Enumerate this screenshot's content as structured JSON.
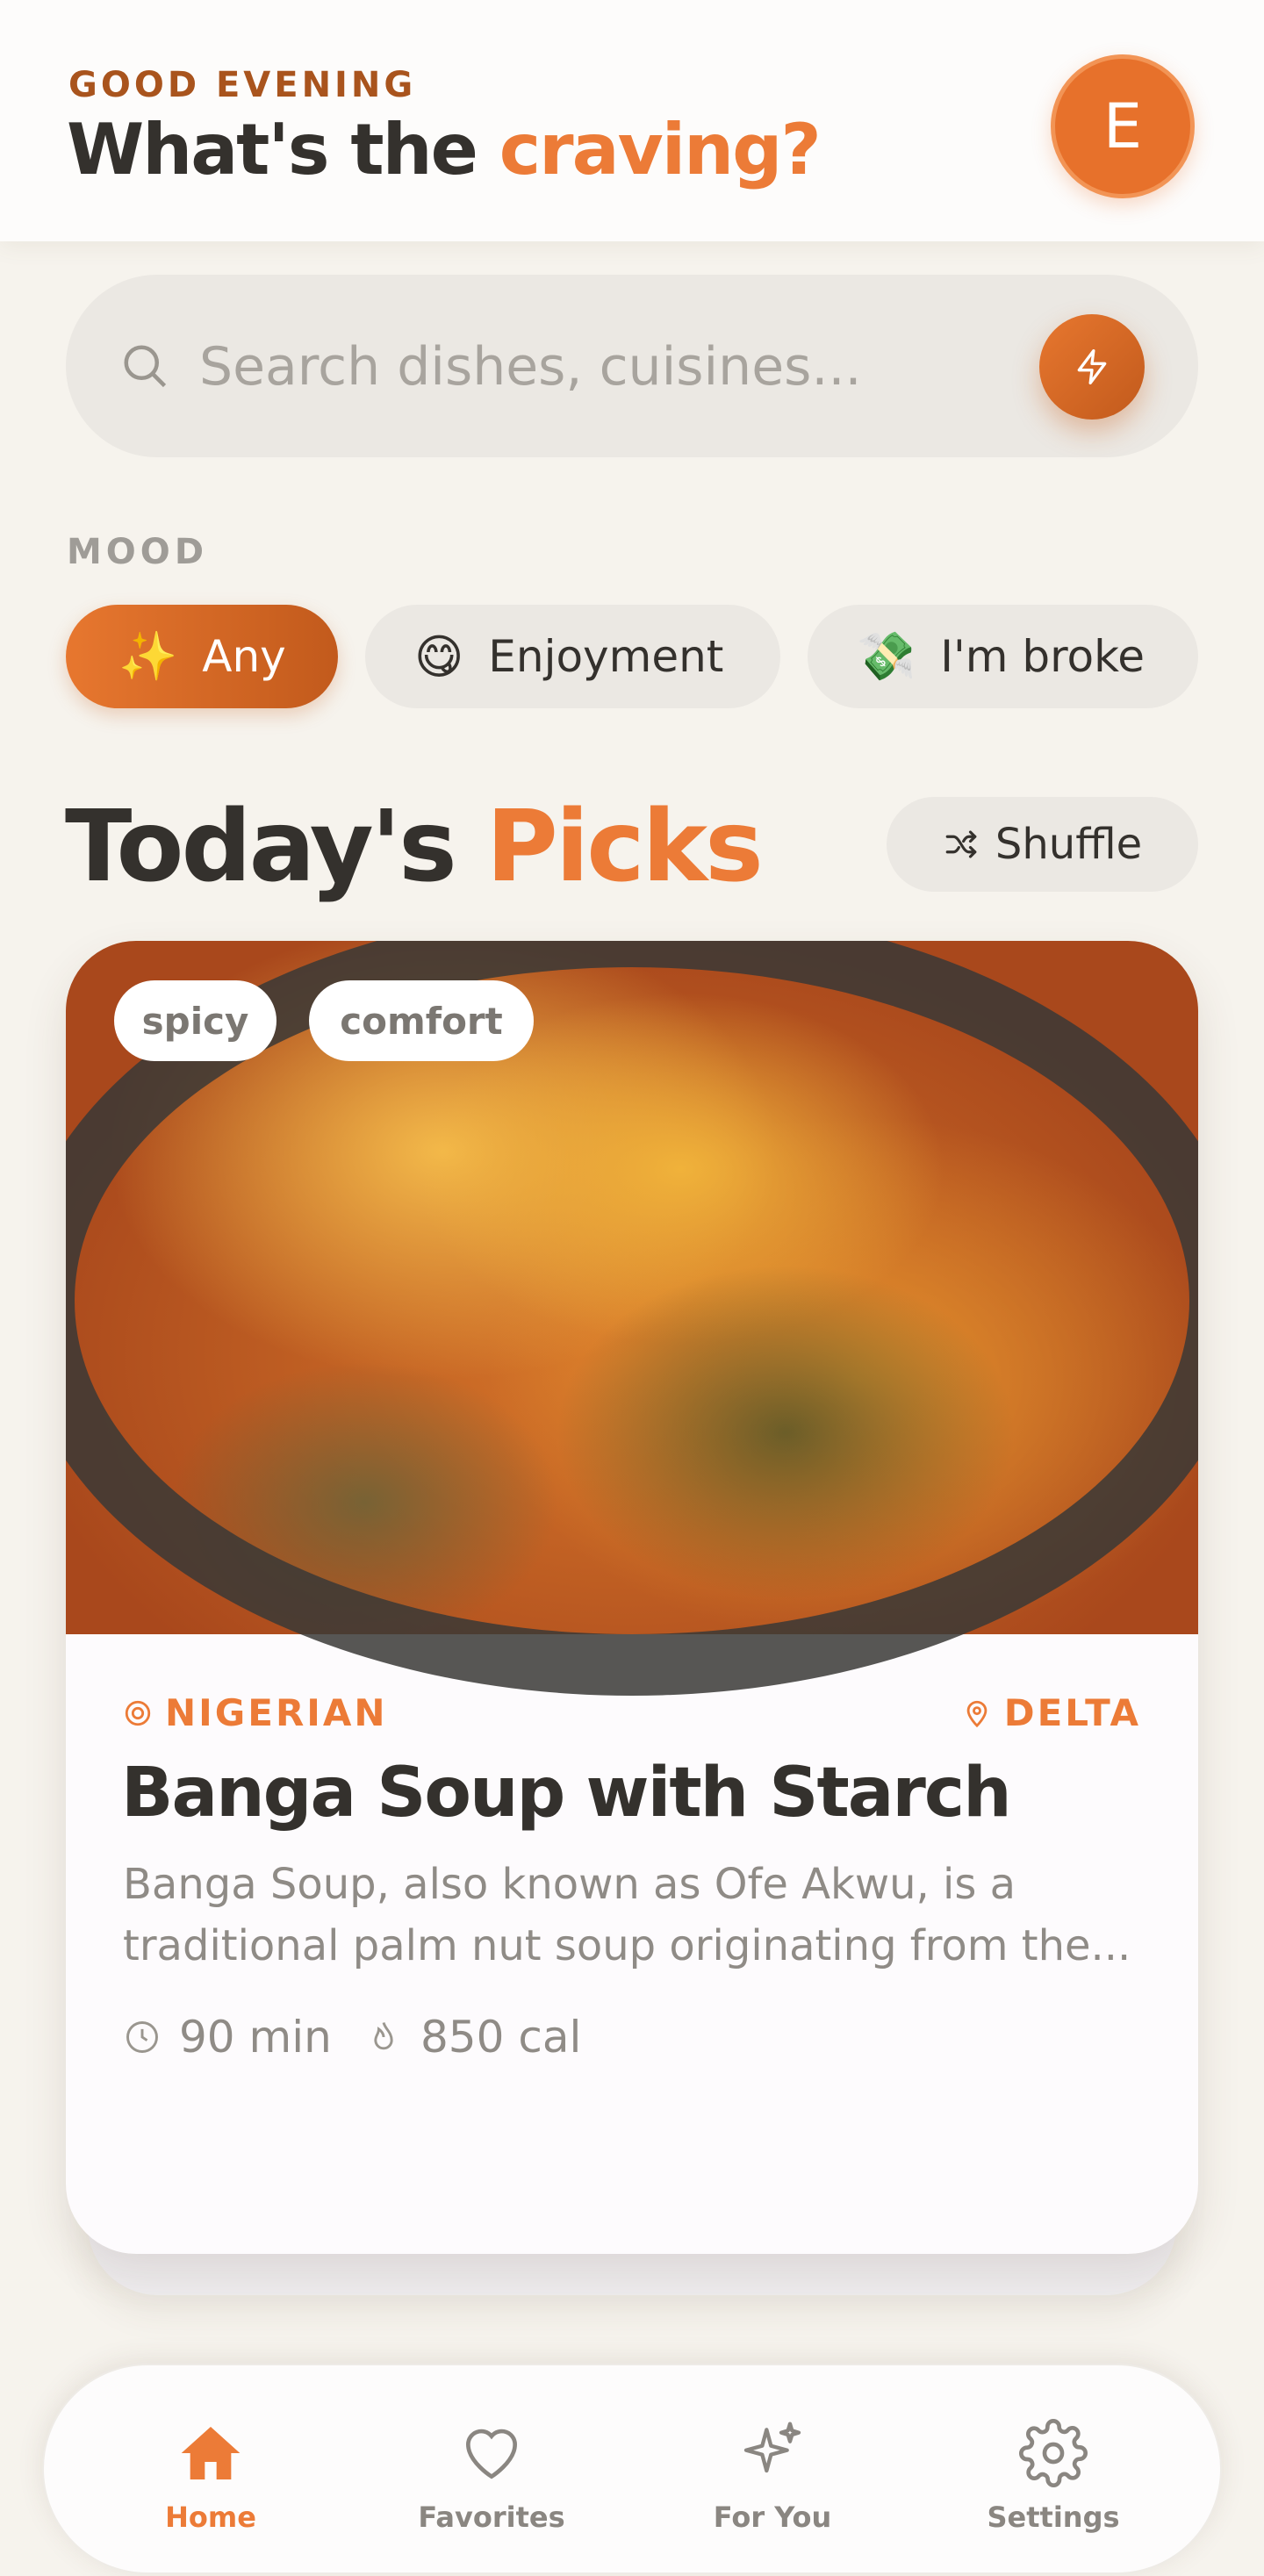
{
  "header": {
    "greeting": "GOOD EVENING",
    "title_prefix": "What's the",
    "title_accent": "craving?",
    "avatar_initial": "E"
  },
  "search": {
    "placeholder": "Search dishes, cuisines...",
    "action_icon": "bolt-icon"
  },
  "mood": {
    "label": "MOOD",
    "chips": [
      {
        "emoji": "✨",
        "label": "Any",
        "selected": true
      },
      {
        "emoji": "😋",
        "label": "Enjoyment",
        "selected": false
      },
      {
        "emoji": "💸",
        "label": "I'm broke",
        "selected": false
      }
    ]
  },
  "picks": {
    "title_prefix": "Today's",
    "title_accent": "Picks",
    "shuffle_label": "Shuffle"
  },
  "card": {
    "tags": [
      "spicy",
      "comfort"
    ],
    "cuisine": "NIGERIAN",
    "region": "DELTA",
    "name": "Banga Soup with Starch",
    "description": "Banga Soup, also known as Ofe Akwu, is a traditional palm nut soup originating from the...",
    "time": "90 min",
    "calories": "850 cal"
  },
  "nav": {
    "items": [
      {
        "label": "Home",
        "icon": "home-icon",
        "active": true
      },
      {
        "label": "Favorites",
        "icon": "heart-icon",
        "active": false
      },
      {
        "label": "For You",
        "icon": "sparkles-icon",
        "active": false
      },
      {
        "label": "Settings",
        "icon": "gear-icon",
        "active": false
      }
    ]
  },
  "colors": {
    "accent": "#ec7b37",
    "accent_dark": "#c25a1c",
    "background": "#f6f3ed"
  }
}
